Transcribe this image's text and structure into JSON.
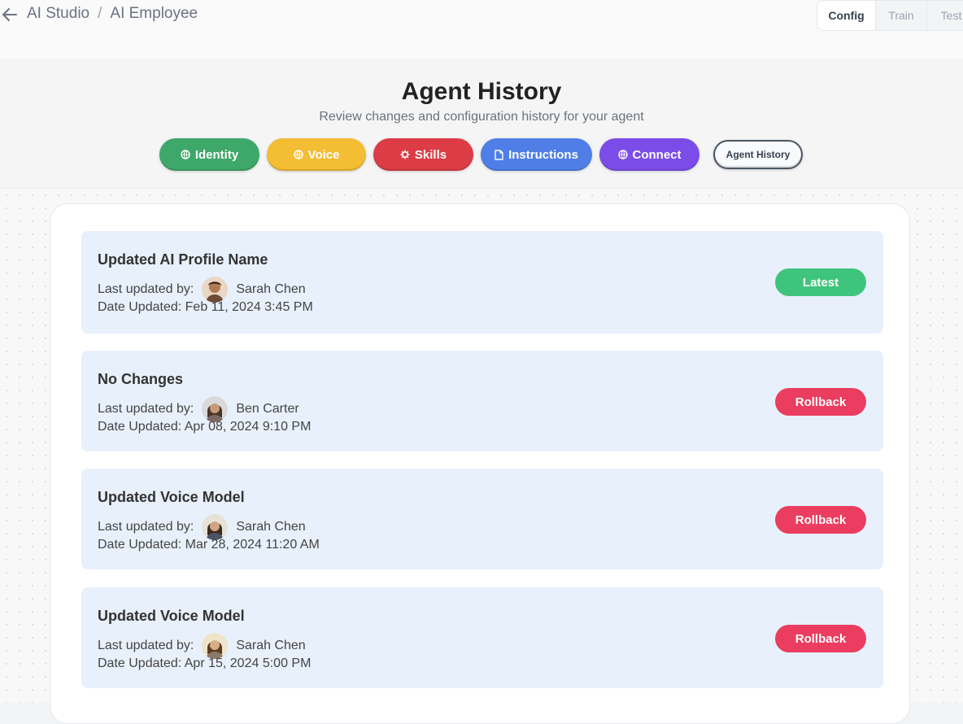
{
  "breadcrumb": {
    "root": "AI Studio",
    "separator": "/",
    "current": "AI Employee"
  },
  "top_tabs": [
    {
      "label": "Config",
      "active": true
    },
    {
      "label": "Train",
      "active": false
    },
    {
      "label": "Test",
      "active": false
    }
  ],
  "header": {
    "title": "Agent History",
    "subtitle": "Review changes and configuration history for your agent"
  },
  "nav_pills": [
    {
      "label": "Identity",
      "icon": "globe-icon",
      "color": "#3ea76a"
    },
    {
      "label": "Voice",
      "icon": "globe-icon",
      "color": "#f3bd34"
    },
    {
      "label": "Skills",
      "icon": "gear-icon",
      "color": "#dc3c45"
    },
    {
      "label": "Instructions",
      "icon": "document-icon",
      "color": "#4f7fe6"
    },
    {
      "label": "Connect",
      "icon": "globe-icon",
      "color": "#7c4ce8"
    },
    {
      "label": "Agent History",
      "icon": "",
      "color": "#f9fafb"
    }
  ],
  "history": {
    "updated_by_label": "Last updated by:",
    "date_label": "Date Updated:",
    "entries": [
      {
        "title": "Updated AI Profile Name",
        "user": "Sarah Chen",
        "date": "Feb 11, 2024 3:45 PM",
        "action": "Latest",
        "action_color": "#3fc47d"
      },
      {
        "title": "No Changes",
        "user": "Ben Carter",
        "date": "Apr 08, 2024 9:10 PM",
        "action": "Rollback",
        "action_color": "#eb3d5f"
      },
      {
        "title": "Updated Voice Model",
        "user": "Sarah Chen",
        "date": "Mar 28, 2024 11:20 AM",
        "action": "Rollback",
        "action_color": "#eb3d5f"
      },
      {
        "title": "Updated Voice Model",
        "user": "Sarah Chen",
        "date": "Apr 15, 2024 5:00 PM",
        "action": "Rollback",
        "action_color": "#eb3d5f"
      }
    ]
  }
}
